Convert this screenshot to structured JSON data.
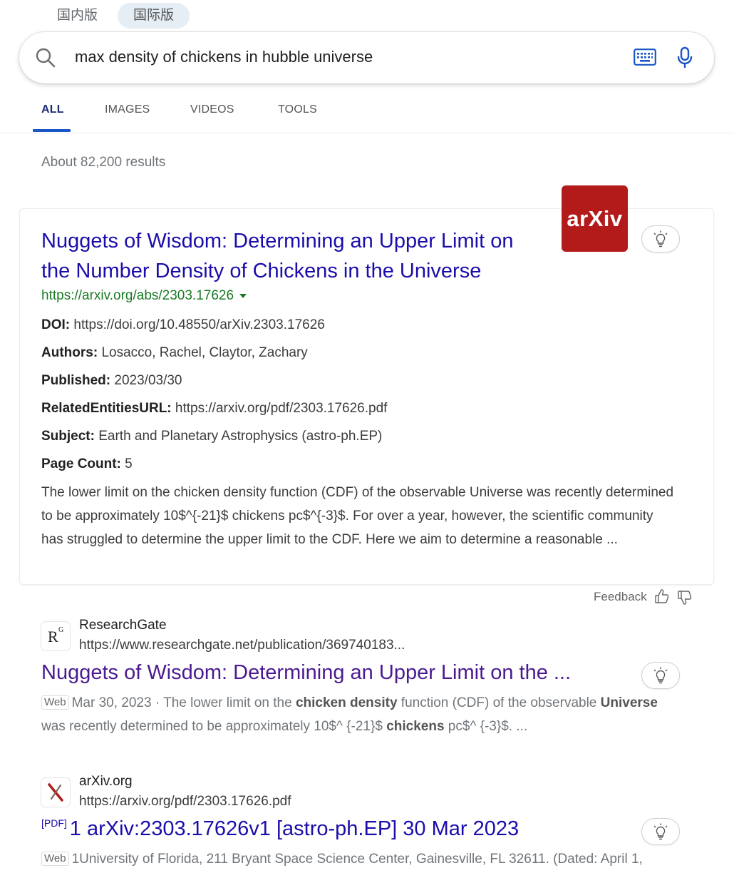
{
  "version_tabs": {
    "domestic": "国内版",
    "international": "国际版"
  },
  "search": {
    "query": "max density of chickens in hubble universe"
  },
  "nav_tabs": [
    "ALL",
    "IMAGES",
    "VIDEOS",
    "TOOLS"
  ],
  "result_count": "About 82,200 results",
  "card": {
    "title_line1": "Nuggets of Wisdom: Determining an Upper Limit on",
    "title_line2": "the Number Density of Chickens in the Universe",
    "url": "https://arxiv.org/abs/2303.17626",
    "logo_text": "arXiv",
    "fields": [
      {
        "label": "DOI:",
        "value": "https://doi.org/10.48550/arXiv.2303.17626"
      },
      {
        "label": "Authors:",
        "value": "Losacco, Rachel, Claytor, Zachary"
      },
      {
        "label": "Published:",
        "value": "2023/03/30"
      },
      {
        "label": "RelatedEntitiesURL:",
        "value": "https://arxiv.org/pdf/2303.17626.pdf"
      },
      {
        "label": "Subject:",
        "value": "Earth and Planetary Astrophysics (astro-ph.EP)"
      },
      {
        "label": "Page Count:",
        "value": "5"
      }
    ],
    "snippet": "The lower limit on the chicken density function (CDF) of the observable Universe was recently determined to be approximately 10$^{-21}$ chickens pc$^{-3}$. For over a year, however, the scientific community has struggled to determine the upper limit to the CDF. Here we aim to determine a reasonable ..."
  },
  "feedback_label": "Feedback",
  "results": [
    {
      "site_name": "ResearchGate",
      "icon_text": "R",
      "icon_sup": "G",
      "url": "https://www.researchgate.net/publication/369740183...",
      "title": "Nuggets of Wisdom: Determining an Upper Limit on the ...",
      "badge": "Web",
      "date": "Mar 30, 2023 ·",
      "snip_1": " The lower limit on the ",
      "bold_1": "chicken density",
      "snip_2": " function (CDF) of the observable ",
      "bold_2": "Universe",
      "snip_3": " was recently determined to be approximately 10$^ {-21}$ ",
      "bold_3": "chickens",
      "snip_4": " pc$^ {-3}$. ..."
    },
    {
      "site_name": "arXiv.org",
      "url": "https://arxiv.org/pdf/2303.17626.pdf",
      "pdf_tag": "[PDF]",
      "title": "1 arXiv:2303.17626v1 [astro-ph.EP] 30 Mar 2023",
      "badge": "Web",
      "snippet": "1University of Florida, 211 Bryant Space Science Center, Gainesville, FL 32611. (Dated: April 1,"
    }
  ],
  "colors": {
    "link_title": "#1a0dab",
    "visited_title": "#4b1a91",
    "url_green": "#1a7a25",
    "accent": "#1a56c6",
    "arxiv_red": "#b31b1b"
  }
}
